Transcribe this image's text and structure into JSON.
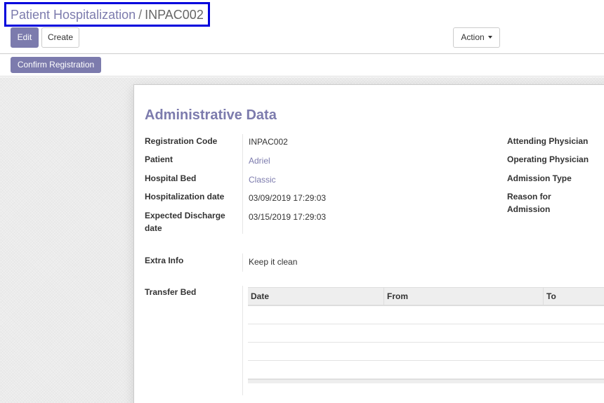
{
  "breadcrumb": {
    "parent": "Patient Hospitalization",
    "separator": "/",
    "current": "INPAC002"
  },
  "toolbar": {
    "edit_label": "Edit",
    "create_label": "Create",
    "action_label": "Action"
  },
  "statusbar": {
    "confirm_label": "Confirm Registration"
  },
  "form": {
    "title": "Administrative Data",
    "left_fields": [
      {
        "label": "Registration Code",
        "value": "INPAC002"
      },
      {
        "label": "Patient",
        "value": "Adriel"
      },
      {
        "label": "Hospital Bed",
        "value": "Classic"
      },
      {
        "label": "Hospitalization date",
        "value": "03/09/2019 17:29:03"
      },
      {
        "label": "Expected Discharge date",
        "value": "03/15/2019 17:29:03"
      }
    ],
    "right_fields": [
      {
        "label": "Attending Physician"
      },
      {
        "label": "Operating Physician"
      },
      {
        "label": "Admission Type"
      },
      {
        "label": "Reason for Admission"
      }
    ],
    "extra_info": {
      "label": "Extra Info",
      "value": "Keep it clean"
    },
    "transfer_bed": {
      "label": "Transfer Bed",
      "columns": [
        "Date",
        "From",
        "To"
      ]
    }
  },
  "colors": {
    "brand": "#7c7bad",
    "highlight_border": "#0000dd"
  }
}
